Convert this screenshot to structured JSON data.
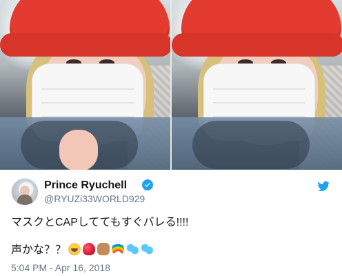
{
  "tweet": {
    "author": {
      "name": "Prince Ryuchell",
      "handle": "@RYUZi33WORLD929"
    },
    "text_lines": [
      "マスクとCAPしててもすぐバレる!!!!",
      "声かな？？"
    ],
    "timestamp": "5:04 PM - Apr 16, 2018"
  },
  "icons": {
    "verified": "verified-badge-icon",
    "twitter": "twitter-bird-icon",
    "emojis": [
      "laughing-tears-emoji",
      "red-heart-emoji",
      "raised-hands-emoji",
      "rainbow-emoji",
      "sweat-droplets-emoji",
      "sweat-droplets-emoji"
    ]
  },
  "colors": {
    "twitter_blue": "#1da1f2",
    "muted_text": "#657786"
  }
}
